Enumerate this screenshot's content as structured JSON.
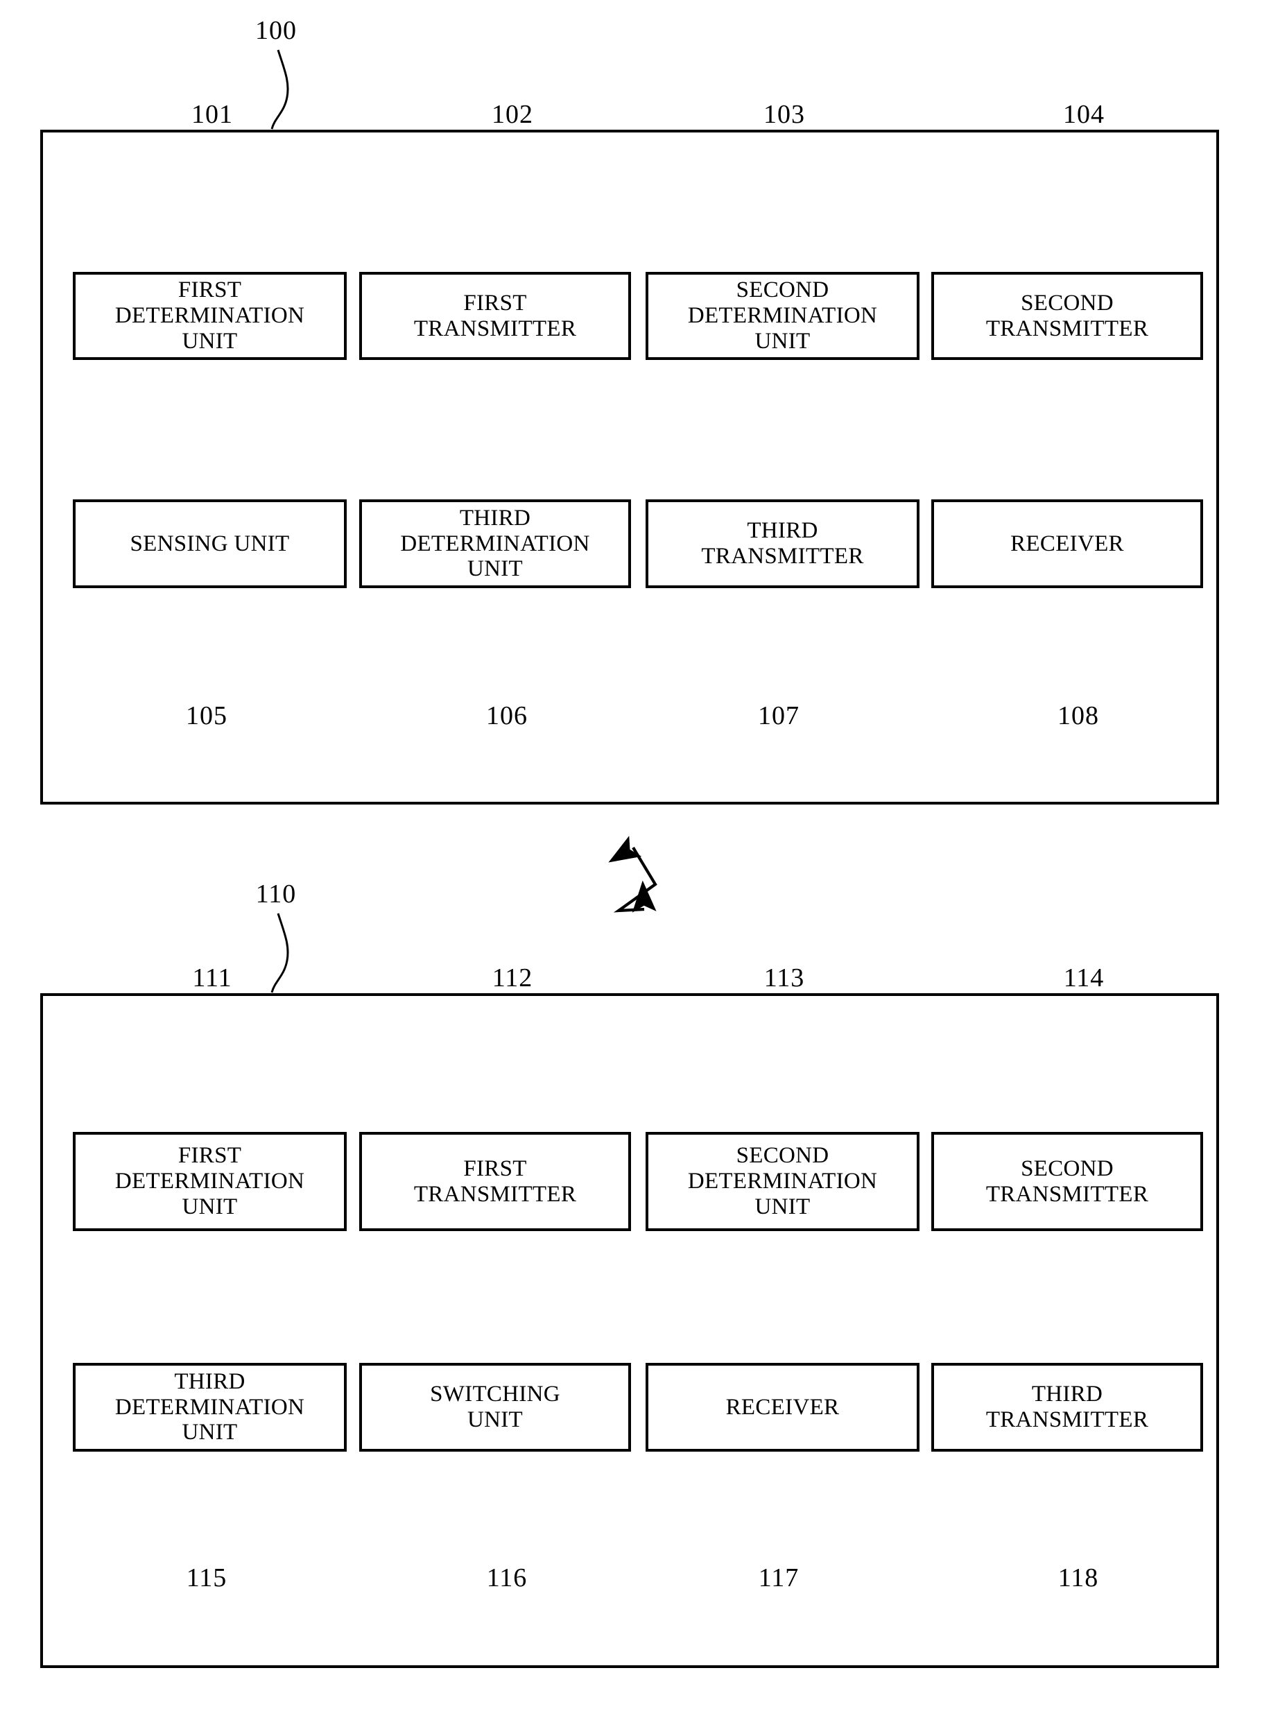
{
  "figure": {
    "title": "",
    "background_color": "#ffffff",
    "line_color": "#000000"
  },
  "panels": [
    {
      "id": "100",
      "ref": "100",
      "top_row": [
        {
          "ref": "101",
          "label": "FIRST\nDETERMINATION\nUNIT"
        },
        {
          "ref": "102",
          "label": "FIRST\nTRANSMITTER"
        },
        {
          "ref": "103",
          "label": "SECOND\nDETERMINATION\nUNIT"
        },
        {
          "ref": "104",
          "label": "SECOND\nTRANSMITTER"
        }
      ],
      "bottom_row": [
        {
          "ref": "105",
          "label": "SENSING UNIT"
        },
        {
          "ref": "106",
          "label": "THIRD\nDETERMINATION\nUNIT"
        },
        {
          "ref": "107",
          "label": "THIRD\nTRANSMITTER"
        },
        {
          "ref": "108",
          "label": "RECEIVER"
        }
      ]
    },
    {
      "id": "110",
      "ref": "110",
      "top_row": [
        {
          "ref": "111",
          "label": "FIRST\nDETERMINATION\nUNIT"
        },
        {
          "ref": "112",
          "label": "FIRST\nTRANSMITTER"
        },
        {
          "ref": "113",
          "label": "SECOND\nDETERMINATION\nUNIT"
        },
        {
          "ref": "114",
          "label": "SECOND\nTRANSMITTER"
        }
      ],
      "bottom_row": [
        {
          "ref": "115",
          "label": "THIRD\nDETERMINATION\nUNIT"
        },
        {
          "ref": "116",
          "label": "SWITCHING\nUNIT"
        },
        {
          "ref": "117",
          "label": "RECEIVER"
        },
        {
          "ref": "118",
          "label": "THIRD\nTRANSMITTER"
        }
      ]
    }
  ],
  "connectors": {
    "wireless_link_icon": "lightning-bolt-double-arrow",
    "bus_line": "horizontal-bus",
    "arrow_type": "double-headed-vertical"
  }
}
